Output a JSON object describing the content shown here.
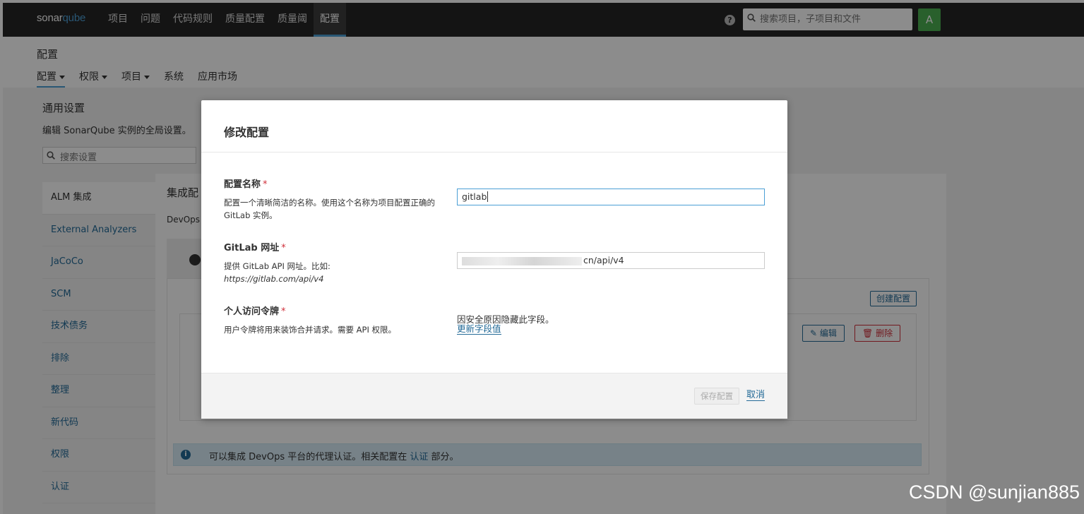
{
  "topnav": {
    "logo_main": "sonar",
    "logo_accent": "qube",
    "links": [
      "项目",
      "问题",
      "代码规则",
      "质量配置",
      "质量阈",
      "配置"
    ],
    "search_placeholder": "搜索项目，子项目和文件",
    "avatar_letter": "A"
  },
  "page": {
    "title": "配置",
    "subnav": [
      "配置",
      "权限",
      "项目",
      "系统",
      "应用市场"
    ]
  },
  "settings": {
    "title": "通用设置",
    "description": "编辑 SonarQube 实例的全局设置。",
    "search_placeholder": "搜索设置",
    "menu": [
      "ALM 集成",
      "External Analyzers",
      "JaCoCo",
      "SCM",
      "技术债务",
      "排除",
      "整理",
      "新代码",
      "权限",
      "认证"
    ]
  },
  "panel": {
    "title": "集成配",
    "desc": "DevOps",
    "create_button": "创建配置",
    "edit_button": "编辑",
    "delete_button": "删除",
    "info_text_before": "可以集成 DevOps 平台的代理认证。相关配置在",
    "info_link": "认证",
    "info_text_after": "部分。"
  },
  "modal": {
    "title": "修改配置",
    "name_label": "配置名称",
    "name_desc": "配置一个清晰简洁的名称。使用这个名称为项目配置正确的 GitLab 实例。",
    "name_value": "gitlab",
    "url_label": "GitLab 网址",
    "url_desc": "提供 GitLab API 网址。比如:",
    "url_example": "https://gitlab.com/api/v4",
    "url_value_visible": "cn/api/v4",
    "token_label": "个人访问令牌",
    "token_desc": "用户令牌将用来装饰合并请求。需要 API 权限。",
    "token_hidden_note": "因安全原因隐藏此字段。",
    "token_update_link": "更新字段值",
    "required_mark": "*",
    "save_button": "保存配置",
    "cancel_button": "取消"
  },
  "watermark": "CSDN @sunjian885"
}
